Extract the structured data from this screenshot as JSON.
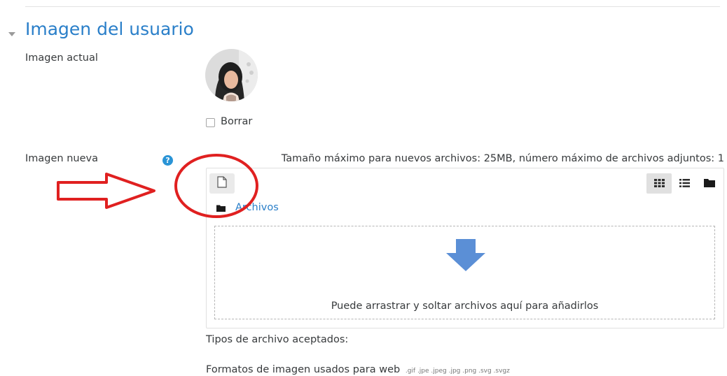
{
  "section": {
    "title": "Imagen del usuario",
    "toggle_icon": "caret-down-icon"
  },
  "current_image": {
    "label": "Imagen actual",
    "avatar_icon": "user-avatar"
  },
  "delete_option": {
    "label": "Borrar",
    "checked": false
  },
  "new_image": {
    "label": "Imagen nueva",
    "help_icon": "question-circle-icon",
    "help_glyph": "?",
    "max_info": "Tamaño máximo para nuevos archivos: 25MB, número máximo de archivos adjuntos: 1"
  },
  "filepicker": {
    "add_icon": "file-icon",
    "view_icons": [
      "grid-icon",
      "list-icon",
      "folder-icon"
    ],
    "path_icon": "folder-icon",
    "path_label": "Archivos",
    "drop_text": "Puede arrastrar y soltar archivos aquí para añadirlos",
    "drop_icon": "arrow-down-icon"
  },
  "accepted": {
    "title": "Tipos de archivo aceptados:",
    "formats_label": "Formatos de imagen usados para web",
    "extensions": ".gif .jpe .jpeg .jpg .png .svg .svgz"
  },
  "colors": {
    "link": "#2a7fc9",
    "annotation": "#e02020",
    "drop_arrow": "#5b8fd6"
  }
}
